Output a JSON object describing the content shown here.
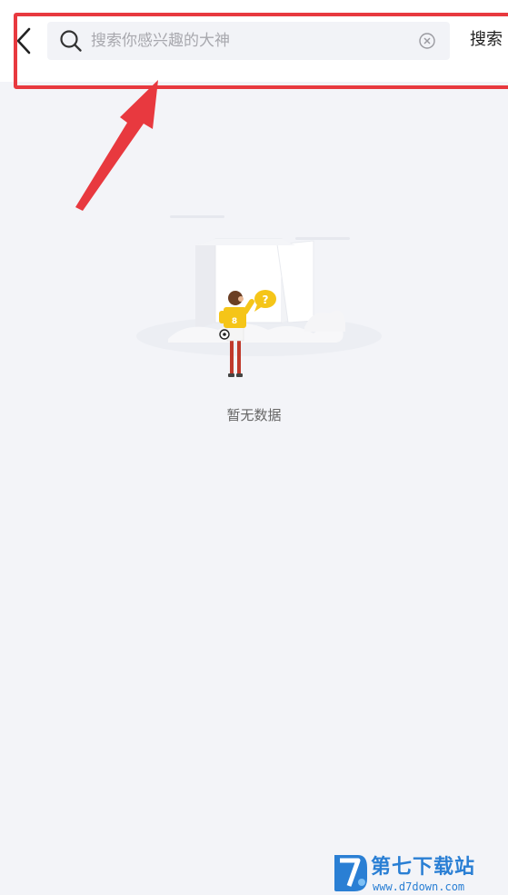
{
  "header": {
    "search_placeholder": "搜索你感兴趣的大神",
    "search_value": "",
    "search_button_label": "搜索"
  },
  "empty_state": {
    "message": "暂无数据",
    "jersey_number": "8"
  },
  "watermark": {
    "name": "第七下载站",
    "url": "www.d7down.com"
  },
  "colors": {
    "annotation_red": "#e8393f",
    "jersey_yellow": "#f5c518",
    "page_background": "#f3f4f8",
    "watermark_blue": "#2a7fd4"
  }
}
